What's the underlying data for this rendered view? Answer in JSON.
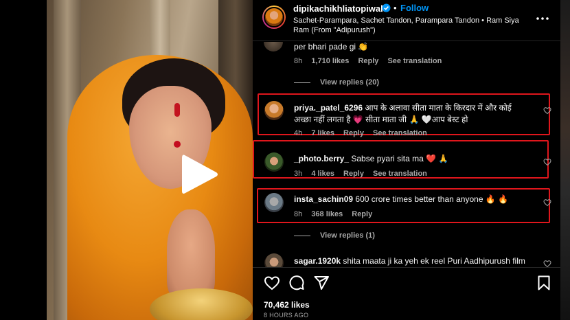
{
  "post": {
    "username": "dipikachikhliatopiwala",
    "follow_label": "Follow",
    "separator": "•",
    "audio": "Sachet-Parampara, Sachet Tandon, Parampara Tandon • Ram Siya Ram (From \"Adipurush\")",
    "likes": "70,462 likes",
    "time": "8 HOURS AGO"
  },
  "comments": [
    {
      "username": "",
      "text": "per bhari pade gi 👏",
      "age": "8h",
      "likes": "1,710 likes",
      "reply_label": "Reply",
      "translate_label": "See translation",
      "view_replies": "View replies (20)",
      "highlighted": false
    },
    {
      "username": "priya._patel_6296",
      "text": "आप के अलावा सीता माता के किरदार में और कोई अच्छा नहीं लगता है 💗 सीता माता जी 🙏 🤍आप बेस्ट हो",
      "age": "4h",
      "likes": "7 likes",
      "reply_label": "Reply",
      "translate_label": "See translation",
      "highlighted": true
    },
    {
      "username": "_photo.berry_",
      "text": "Sabse pyari sita ma ❤️ 🙏",
      "age": "3h",
      "likes": "4 likes",
      "reply_label": "Reply",
      "translate_label": "See translation",
      "highlighted": true
    },
    {
      "username": "insta_sachin09",
      "text": "600 crore times better than anyone 🔥 🔥",
      "age": "8h",
      "likes": "368 likes",
      "reply_label": "Reply",
      "view_replies": "View replies (1)",
      "highlighted": true
    },
    {
      "username": "sagar.1920k",
      "text": "shita maata ji ka yeh ek reel Puri Aadhipurush film",
      "highlighted": false
    }
  ],
  "icons": {
    "play": "play-icon",
    "verified": "verified-badge-icon",
    "more": "more-options-icon",
    "like": "heart-icon",
    "comment": "comment-icon",
    "share": "share-icon",
    "save": "bookmark-icon"
  },
  "colors": {
    "accent": "#0095f6",
    "highlight_box": "#e0161c",
    "muted_text": "#a8a8a8"
  }
}
